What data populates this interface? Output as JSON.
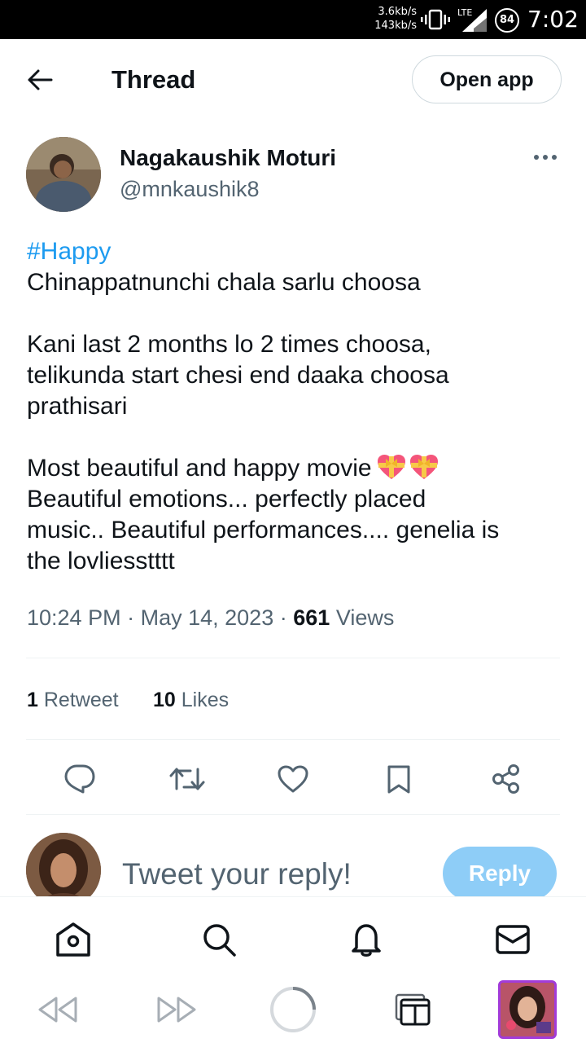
{
  "status_bar": {
    "upload_speed": "3.6kb/s",
    "download_speed": "143kb/s",
    "network": "LTE",
    "battery": "84",
    "time": "7:02"
  },
  "header": {
    "back_icon": "arrow-left-icon",
    "title": "Thread",
    "open_app_label": "Open app"
  },
  "tweet": {
    "author_name": "Nagakaushik Moturi",
    "author_handle": "@mnkaushik8",
    "hashtag": "#Happy",
    "lines": [
      "Chinappatnunchi chala sarlu choosa",
      "",
      "Kani last 2 months lo 2 times choosa,",
      "telikunda start chesi end daaka choosa",
      "prathisari",
      "",
      "Most beautiful and happy movie",
      "Beautiful emotions... perfectly placed",
      "music.. Beautiful performances.... genelia is",
      "the lovliesstttt"
    ],
    "emoji": [
      "heart-with-ribbon",
      "heart-with-ribbon"
    ],
    "time": "10:24 PM",
    "date": "May 14, 2023",
    "views_count": "661",
    "views_label": "Views",
    "retweets_count": "1",
    "retweets_label": "Retweet",
    "likes_count": "10",
    "likes_label": "Likes"
  },
  "actions": [
    "reply-icon",
    "retweet-icon",
    "like-icon",
    "bookmark-icon",
    "share-icon"
  ],
  "reply_composer": {
    "placeholder": "Tweet your reply!",
    "button_label": "Reply"
  },
  "bottom_nav": [
    "home-icon",
    "search-icon",
    "notifications-icon",
    "messages-icon"
  ],
  "browser_bar": [
    "back-icon",
    "forward-icon",
    "reload-icon",
    "tabs-icon",
    "profile-avatar"
  ],
  "colors": {
    "accent": "#1d9bf0",
    "reply_button_disabled": "#8ecdf7",
    "secondary_text": "#536471",
    "primary_text": "#0f1419"
  }
}
